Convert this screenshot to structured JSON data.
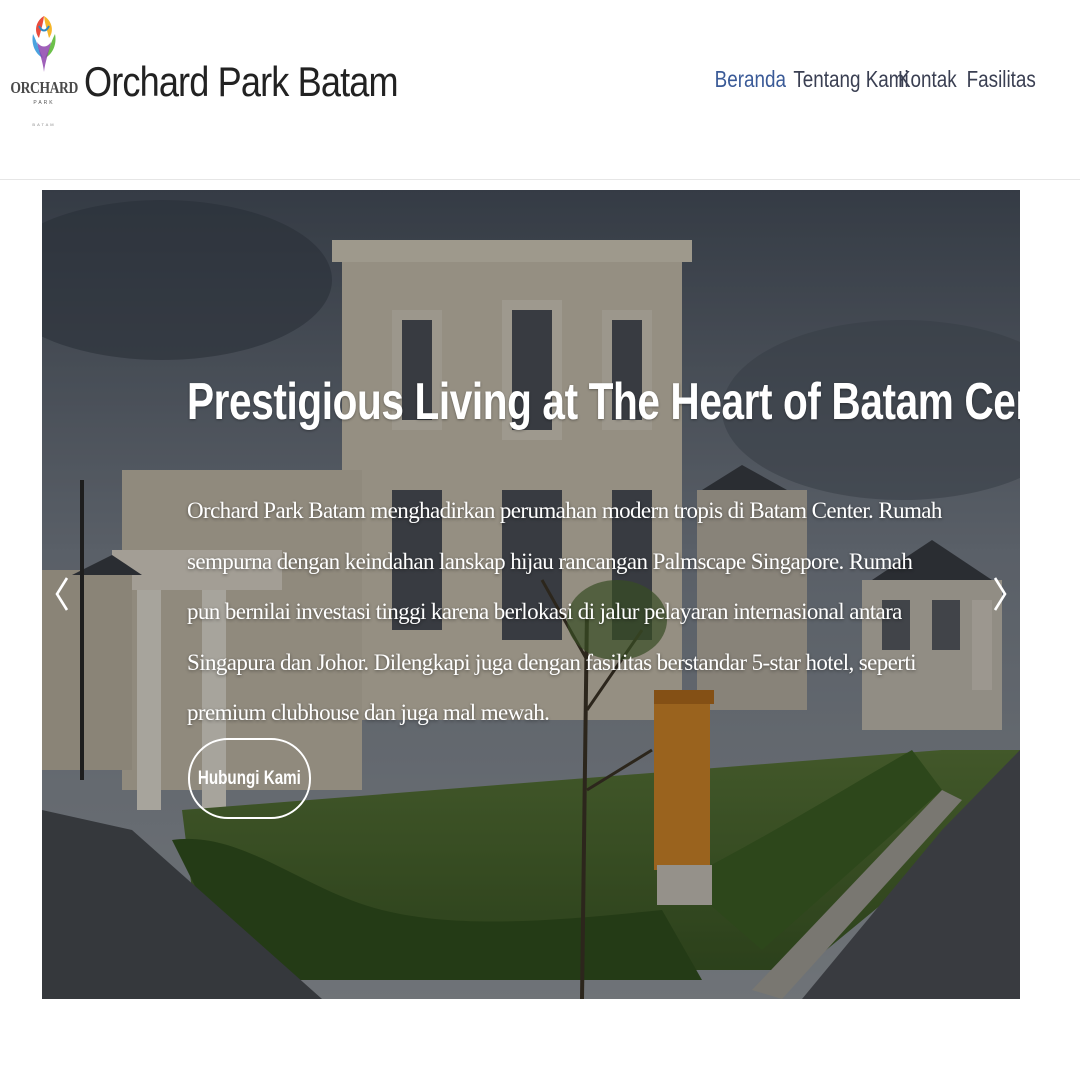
{
  "header": {
    "logo": {
      "word": "ORCHARD",
      "sub1": "PARK",
      "sub2": "BATAM"
    },
    "site_title": "Orchard Park Batam",
    "nav": [
      {
        "label": "Beranda",
        "active": true
      },
      {
        "label": "Tentang Kami",
        "active": false
      },
      {
        "label": "Kontak",
        "active": false
      },
      {
        "label": "Fasilitas",
        "active": false
      }
    ]
  },
  "hero": {
    "title": "Prestigious Living at The Heart of Batam Center",
    "description": "Orchard Park Batam menghadirkan perumahan modern tropis di Batam Center. Rumah sempurna dengan keindahan lanskap hijau rancangan Palmscape Singapore. Rumah pun bernilai investasi tinggi karena berlokasi di jalur pelayaran internasional antara Singapura dan Johor. Dilengkapi juga dengan fasilitas berstandar 5-star hotel, seperti premium clubhouse dan juga mal mewah.",
    "cta_label": "Hubungi Kami",
    "prev_icon": "chevron-left-icon",
    "next_icon": "chevron-right-icon"
  },
  "colors": {
    "nav_active": "#3a5a97",
    "nav_default": "#3a3f52",
    "brand_text": "#222222"
  }
}
